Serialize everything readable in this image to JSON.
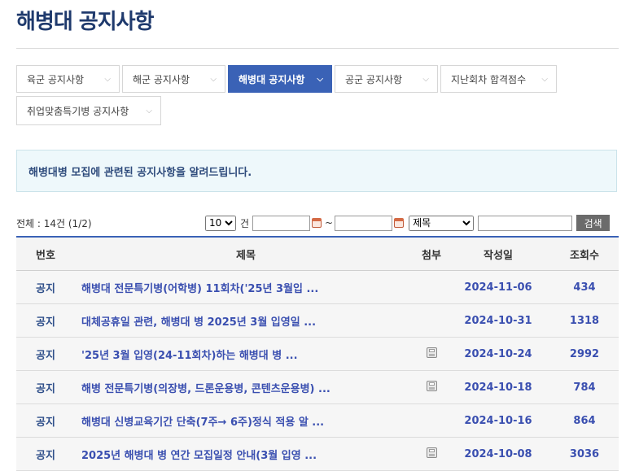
{
  "page": {
    "title": "해병대 공지사항"
  },
  "tabs": [
    {
      "label": "육군 공지사항",
      "active": false
    },
    {
      "label": "해군 공지사항",
      "active": false
    },
    {
      "label": "해병대 공지사항",
      "active": true
    },
    {
      "label": "공군 공지사항",
      "active": false
    },
    {
      "label": "지난회차 합격점수",
      "active": false
    },
    {
      "label": "취업맞춤특기병 공지사항",
      "active": false
    }
  ],
  "info": {
    "text": "해병대병 모집에 관련된 공지사항을 알려드립니다."
  },
  "summary": {
    "text": "전체 : 14건 (1/2)"
  },
  "search": {
    "page_size": "10",
    "unit": "건",
    "date_from": "",
    "date_to": "",
    "range_sep": "~",
    "field": "제목",
    "keyword": "",
    "button": "검색"
  },
  "table": {
    "headers": {
      "no": "번호",
      "title": "제목",
      "attach": "첨부",
      "date": "작성일",
      "views": "조회수"
    },
    "rows": [
      {
        "no": "공지",
        "title": "해병대 전문특기병(어학병) 11회차('25년 3월입 ...",
        "attach": false,
        "date": "2024-11-06",
        "views": "434"
      },
      {
        "no": "공지",
        "title": "대체공휴일 관련, 해병대 병 2025년 3월 입영일 ...",
        "attach": false,
        "date": "2024-10-31",
        "views": "1318"
      },
      {
        "no": "공지",
        "title": "'25년 3월 입영(24-11회차)하는 해병대 병 ...",
        "attach": true,
        "date": "2024-10-24",
        "views": "2992"
      },
      {
        "no": "공지",
        "title": "해병 전문특기병(의장병, 드론운용병, 콘텐츠운용병) ...",
        "attach": true,
        "date": "2024-10-18",
        "views": "784"
      },
      {
        "no": "공지",
        "title": "해병대 신병교육기간 단축(7주→ 6주)정식 적용 알 ...",
        "attach": false,
        "date": "2024-10-16",
        "views": "864"
      },
      {
        "no": "공지",
        "title": "2025년 해병대 병 연간 모집일정 안내(3월 입영 ...",
        "attach": true,
        "date": "2024-10-08",
        "views": "3036"
      }
    ]
  },
  "icons": {
    "dropdown": "chevron-down-icon",
    "calendar": "calendar-icon",
    "attachment": "file-attachment-icon"
  },
  "colors": {
    "title": "#1f3a6d",
    "accent": "#3a62b6",
    "link": "#3a4fb0",
    "info_bg": "#eef8fb"
  }
}
